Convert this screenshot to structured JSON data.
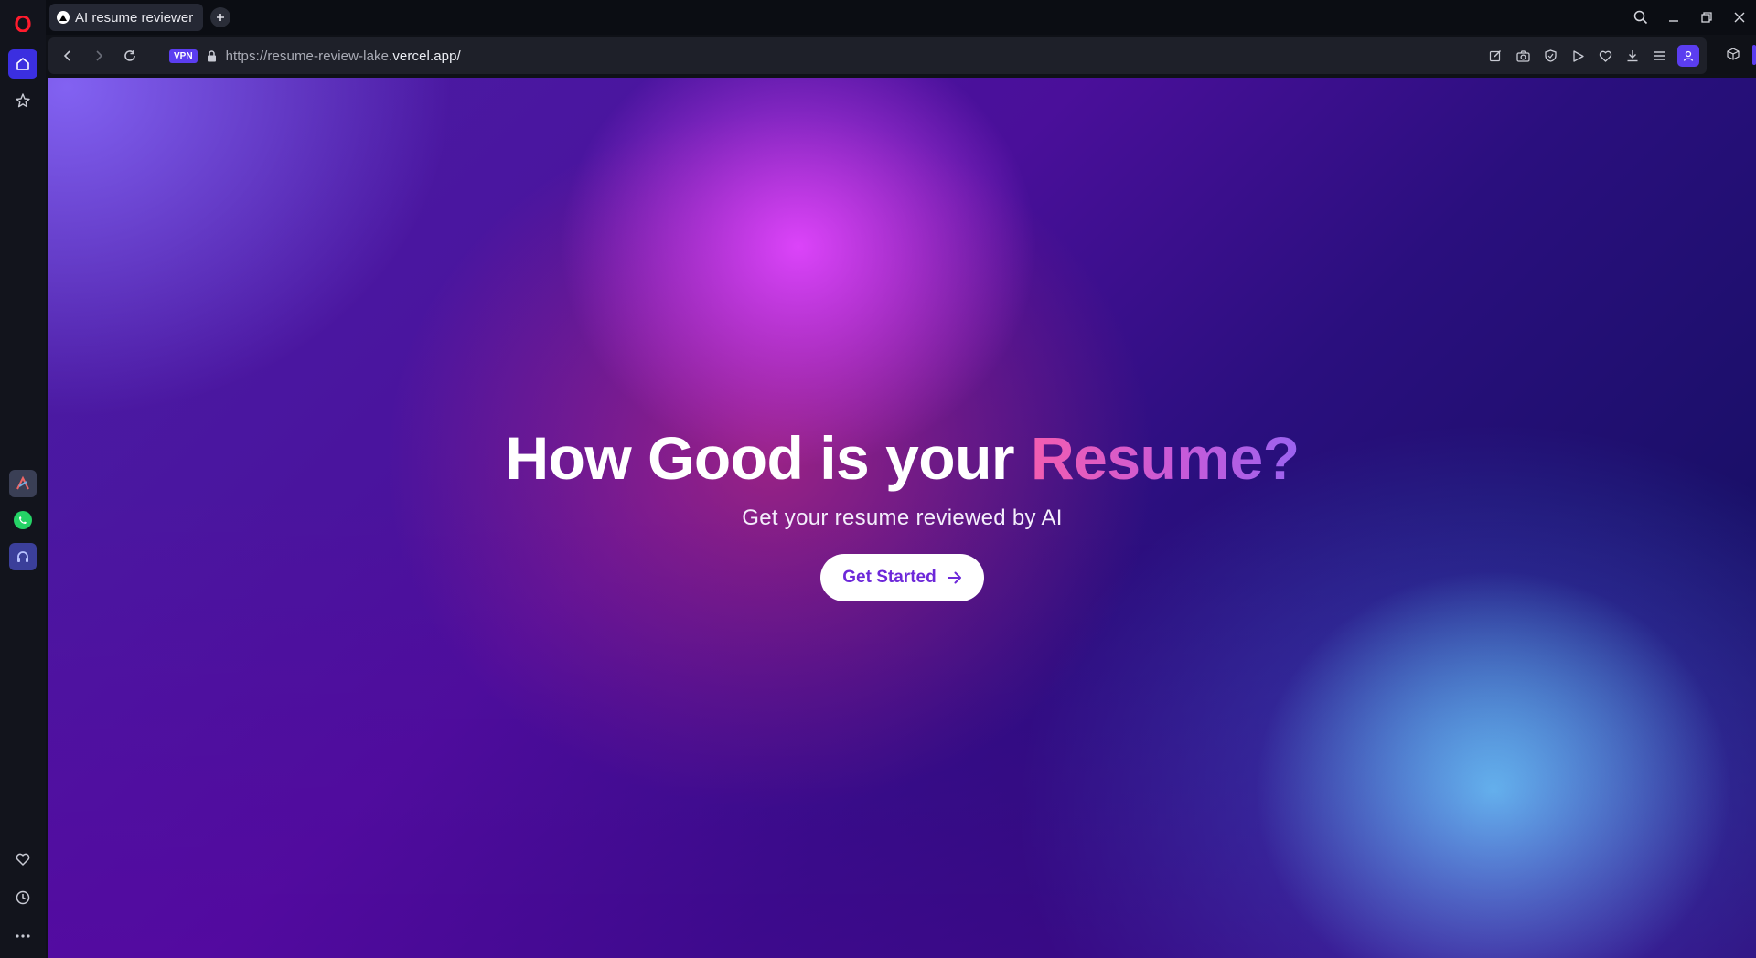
{
  "browser": {
    "tab": {
      "title": "AI resume reviewer"
    },
    "url": {
      "prefix": "https://resume-review-lake.",
      "host": "vercel.app/"
    },
    "vpn_badge": "VPN",
    "accent_color": "#5b3df0"
  },
  "sidebar": {
    "top_items": [
      "opera-logo",
      "home-icon",
      "star-icon"
    ],
    "apps": [
      "aria-icon",
      "whatsapp-icon",
      "music-icon"
    ],
    "bottom_items": [
      "heart-icon",
      "history-icon",
      "more-icon"
    ]
  },
  "page": {
    "headline_main": "How Good is your ",
    "headline_accent": "Resume?",
    "subtitle": "Get your resume reviewed by AI",
    "cta_label": "Get Started",
    "cta_color": "#6d28d9"
  }
}
